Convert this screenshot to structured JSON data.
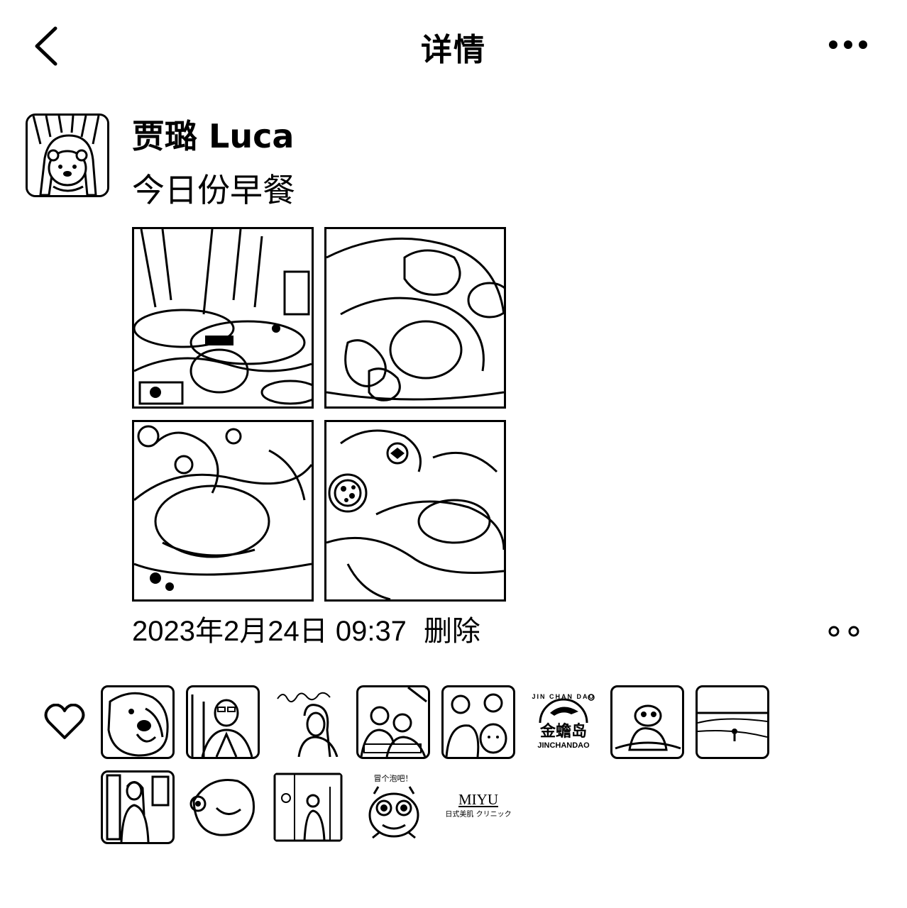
{
  "header": {
    "title": "详情",
    "back_icon": "chevron-left-icon",
    "more_icon": "more-horizontal-icon"
  },
  "post": {
    "author": "贾璐 Luca",
    "text": "今日份早餐",
    "photos": [
      {
        "icon": "breakfast-table-photo"
      },
      {
        "icon": "pastry-plate-photo"
      },
      {
        "icon": "bread-closeup-photo"
      },
      {
        "icon": "fruit-bowl-photo"
      }
    ],
    "timestamp": "2023年2月24日 09:37",
    "delete_label": "删除",
    "comment_icon": "comment-dots-icon"
  },
  "likes": {
    "icon": "heart-outline-icon",
    "avatars": [
      {
        "icon": "dog-avatar"
      },
      {
        "icon": "man-photo-avatar"
      },
      {
        "icon": "calligraphy-portrait-avatar"
      },
      {
        "icon": "group-photo-avatar"
      },
      {
        "icon": "friends-selfie-avatar"
      },
      {
        "icon": "jinchandao-logo-avatar",
        "brand": "金蟾岛",
        "brand_en": "JINCHANDAO",
        "arc_text": "JIN CHAN DAO"
      },
      {
        "icon": "cartoon-animal-avatar"
      },
      {
        "icon": "beach-landscape-avatar"
      },
      {
        "icon": "woman-in-shop-avatar"
      },
      {
        "icon": "cartoon-fish-avatar"
      },
      {
        "icon": "street-scene-avatar"
      },
      {
        "icon": "frog-cartoon-avatar",
        "caption": "冒个泡吧！"
      },
      {
        "icon": "miyu-logo-avatar",
        "brand": "MIYU",
        "sub": "日式美肌 クリニック"
      }
    ]
  }
}
